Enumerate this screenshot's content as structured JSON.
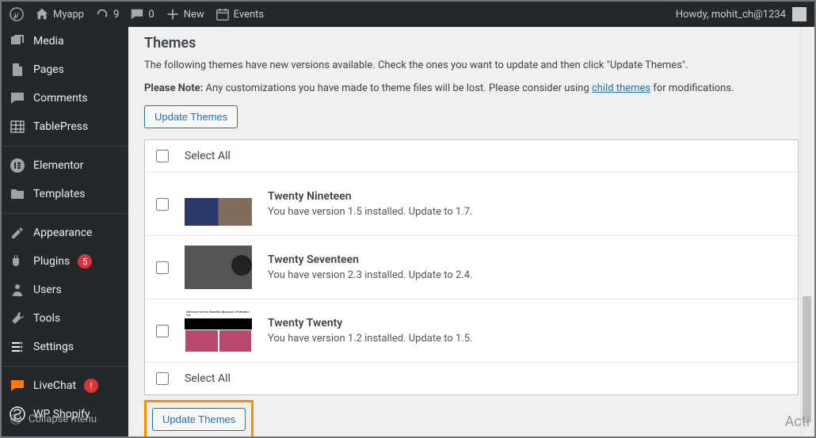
{
  "adminbar": {
    "site_name": "Myapp",
    "updates_count": "9",
    "comments_count": "0",
    "new_label": "New",
    "events_label": "Events",
    "howdy": "Howdy, mohit_ch@1234"
  },
  "sidebar": {
    "items": [
      {
        "label": "Media",
        "icon": "media"
      },
      {
        "label": "Pages",
        "icon": "pages"
      },
      {
        "label": "Comments",
        "icon": "comments"
      },
      {
        "label": "TablePress",
        "icon": "tablepress"
      },
      {
        "label": "Elementor",
        "icon": "elementor"
      },
      {
        "label": "Templates",
        "icon": "templates"
      },
      {
        "label": "Appearance",
        "icon": "appearance"
      },
      {
        "label": "Plugins",
        "icon": "plugins",
        "badge": "5"
      },
      {
        "label": "Users",
        "icon": "users"
      },
      {
        "label": "Tools",
        "icon": "tools"
      },
      {
        "label": "Settings",
        "icon": "settings"
      },
      {
        "label": "LiveChat",
        "icon": "livechat",
        "badge": "!"
      },
      {
        "label": "WP Shopify",
        "icon": "wpshopify"
      }
    ],
    "collapse_label": "Collapse menu"
  },
  "themes_section": {
    "heading": "Themes",
    "description": "The following themes have new versions available. Check the ones you want to update and then click \"Update Themes\".",
    "note_prefix": "Please Note:",
    "note_text_before": " Any customizations you have made to theme files will be lost. Please consider using ",
    "note_link": "child themes",
    "note_text_after": " for modifications.",
    "update_button": "Update Themes",
    "select_all": "Select All",
    "themes": [
      {
        "name": "Twenty Nineteen",
        "status": "You have version 1.5 installed. Update to 1.7."
      },
      {
        "name": "Twenty Seventeen",
        "status": "You have version 2.3 installed. Update to 2.4."
      },
      {
        "name": "Twenty Twenty",
        "status": "You have version 1.2 installed. Update to 1.5."
      }
    ]
  },
  "watermark": "Acti"
}
